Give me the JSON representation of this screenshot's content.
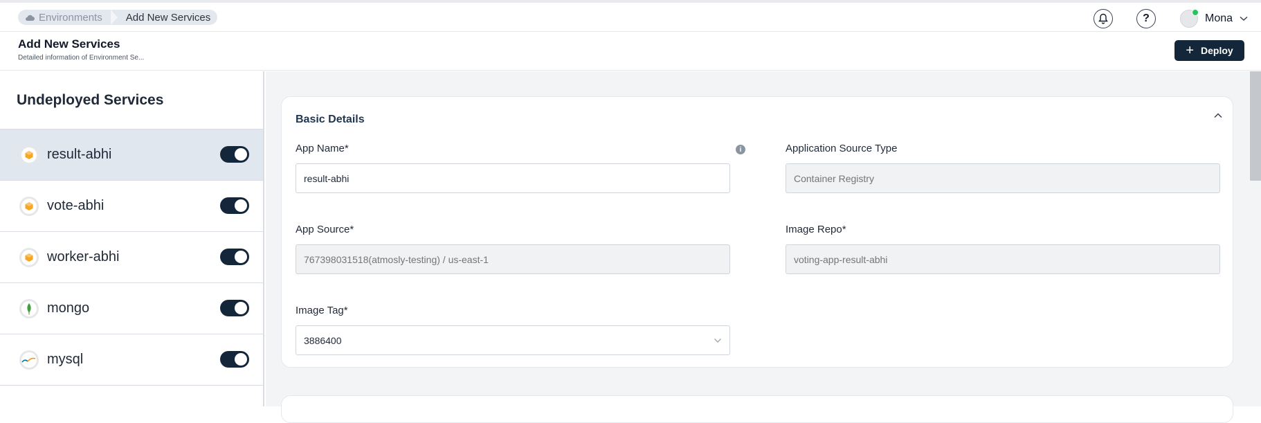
{
  "breadcrumb": {
    "items": [
      {
        "label": "Environments",
        "icon": "cloud-icon"
      },
      {
        "label": "Add New Services"
      }
    ]
  },
  "topbar": {
    "notification_icon": "bell-icon",
    "help_icon": "question-icon",
    "user_name": "Mona"
  },
  "header": {
    "title": "Add New Services",
    "subtitle": "Detailed information of Environment Se...",
    "deploy_label": "Deploy"
  },
  "sidebar": {
    "title": "Undeployed Services",
    "items": [
      {
        "label": "result-abhi",
        "icon": "cube-icon",
        "enabled": true,
        "active": true
      },
      {
        "label": "vote-abhi",
        "icon": "cube-icon",
        "enabled": true
      },
      {
        "label": "worker-abhi",
        "icon": "cube-icon",
        "enabled": true
      },
      {
        "label": "mongo",
        "icon": "mongodb-leaf-icon",
        "enabled": true
      },
      {
        "label": "mysql",
        "icon": "mysql-logo-icon",
        "enabled": true
      }
    ]
  },
  "basic_details": {
    "title": "Basic Details",
    "app_name": {
      "label": "App Name*",
      "value": "result-abhi"
    },
    "source_type": {
      "label": "Application Source Type",
      "placeholder": "Container Registry"
    },
    "app_source": {
      "label": "App Source*",
      "placeholder": "767398031518(atmosly-testing) / us-east-1"
    },
    "image_repo": {
      "label": "Image Repo*",
      "placeholder": "voting-app-result-abhi"
    },
    "image_tag": {
      "label": "Image Tag*",
      "value": "3886400"
    }
  },
  "colors": {
    "primary": "#14263a",
    "active_row": "#e1e7ef",
    "background": "#f3f4f6"
  }
}
